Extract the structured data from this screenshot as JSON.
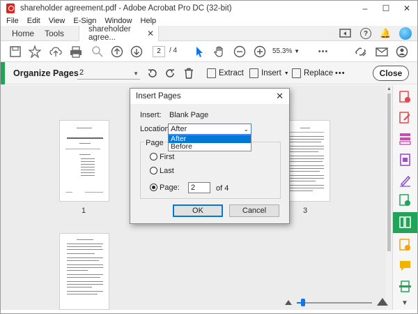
{
  "window": {
    "title": "shareholder agreement.pdf - Adobe Acrobat Pro DC (32-bit)",
    "controls": [
      "–",
      "☐",
      "✕"
    ]
  },
  "menu": [
    "File",
    "Edit",
    "View",
    "E-Sign",
    "Window",
    "Help"
  ],
  "tabs": {
    "home": "Home",
    "tools": "Tools",
    "document": "shareholder agree...",
    "close": "✕"
  },
  "toolbar": {
    "current_page": "2",
    "page_total": "/ 4",
    "zoom": "55.3%",
    "more": "•••"
  },
  "organize": {
    "title": "Organize Pages",
    "page_select": "2",
    "extract": "Extract",
    "insert": "Insert",
    "replace": "Replace",
    "more": "•••",
    "close": "Close",
    "accent_color": "#22a35a"
  },
  "thumbnails": [
    {
      "number": "1"
    },
    {
      "number": "3"
    }
  ],
  "dialog": {
    "title": "Insert Pages",
    "insert_label": "Insert:",
    "insert_value": "Blank Page",
    "location_label": "Location:",
    "location_value": "After",
    "location_options": [
      "After",
      "Before"
    ],
    "page_group": "Page",
    "radio_first": "First",
    "radio_last": "Last",
    "radio_page": "Page:",
    "page_value": "2",
    "page_of": "of 4",
    "ok": "OK",
    "cancel": "Cancel",
    "selected_radio": "page"
  },
  "zoom_slider": {
    "level": 0.07
  },
  "colors": {
    "accent_blue": "#1473e6",
    "green": "#22a35a",
    "selection_blue": "#0078d7"
  }
}
